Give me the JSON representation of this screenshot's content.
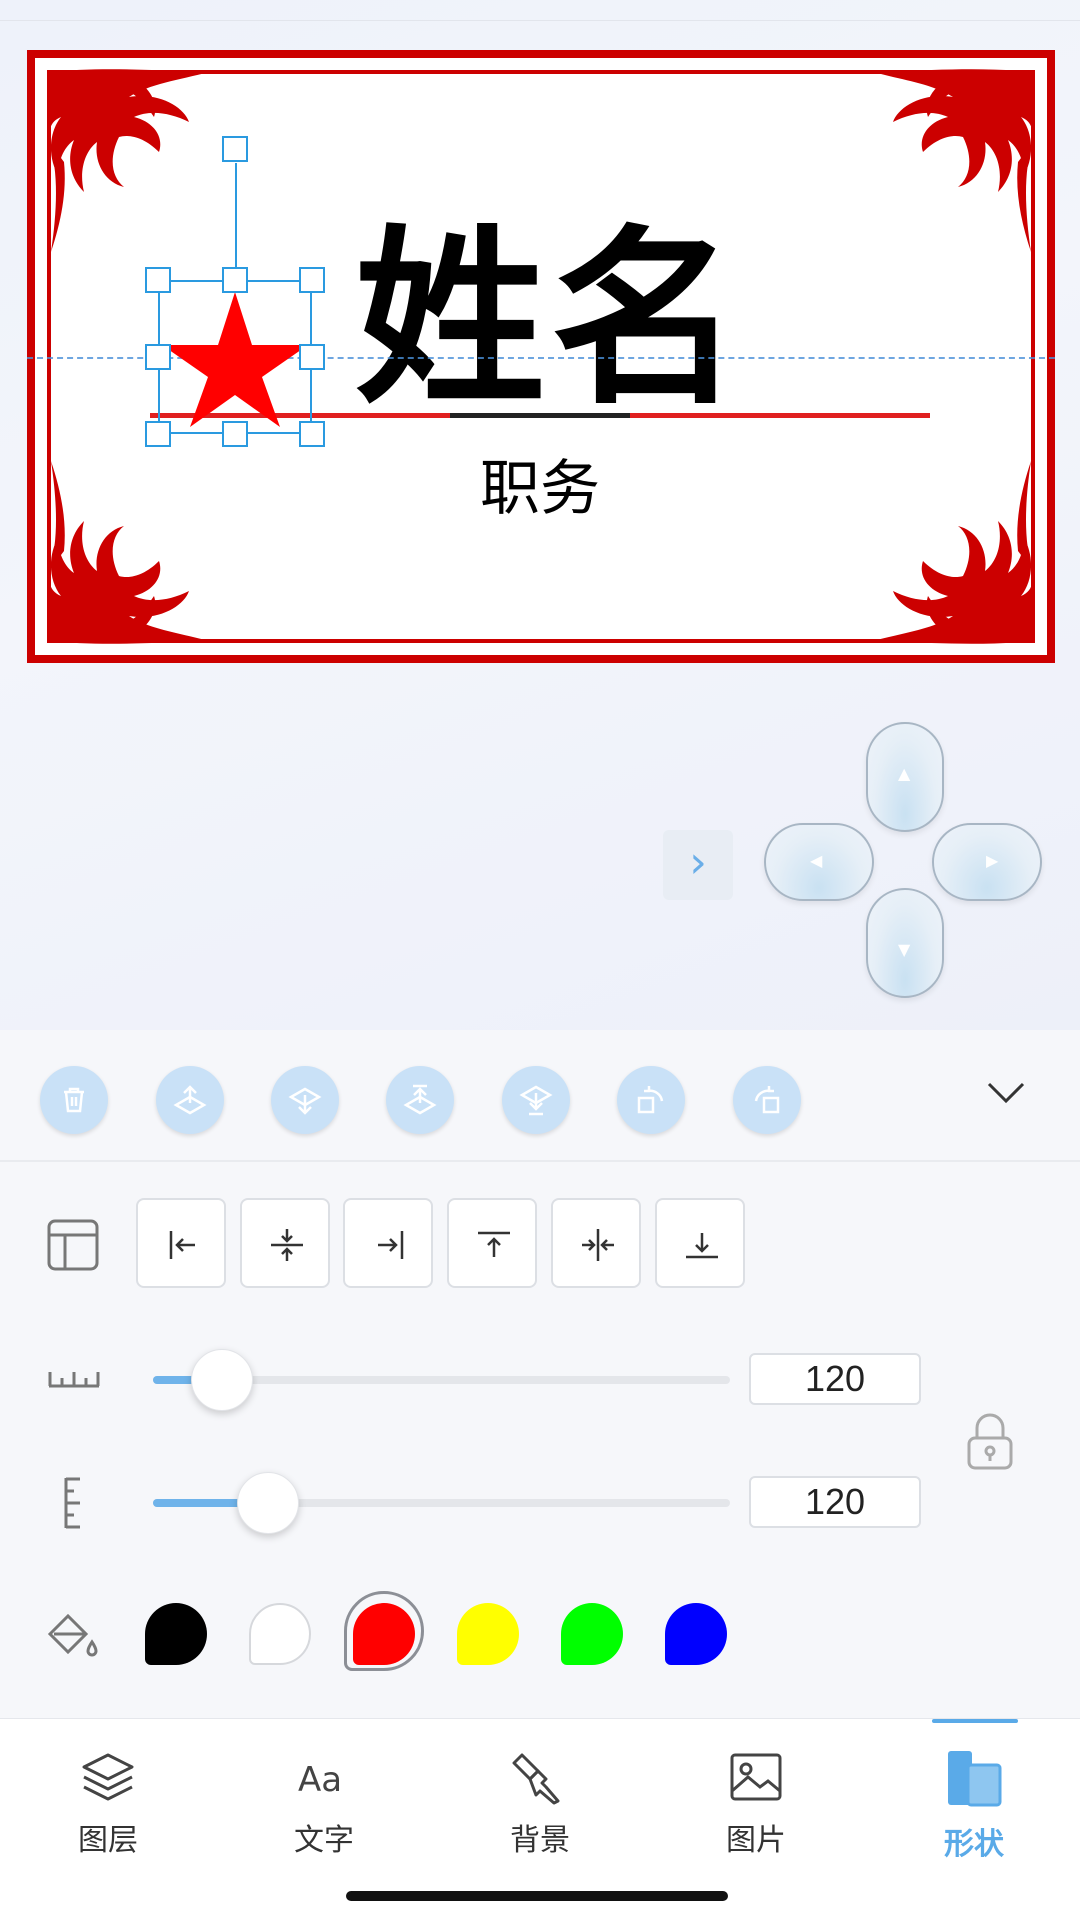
{
  "card": {
    "name_text": "姓名",
    "title_text": "职务",
    "border_color": "#cc0000"
  },
  "dpad": {
    "buttons": [
      "up-icon",
      "left-icon",
      "right-icon",
      "down-icon"
    ]
  },
  "toolbar": {
    "actions": [
      "delete-icon",
      "bring-forward-icon",
      "send-backward-icon",
      "bring-to-front-icon",
      "send-to-back-icon",
      "rotate-left-icon",
      "rotate-right-icon"
    ]
  },
  "align": {
    "buttons": [
      "align-left",
      "align-center-vertical",
      "align-right",
      "align-top",
      "align-center-horizontal",
      "align-bottom"
    ]
  },
  "size": {
    "width_value": "120",
    "height_value": "120",
    "width_fraction": 0.12,
    "height_fraction": 0.2
  },
  "colors": {
    "swatches": [
      "#000000",
      "#ffffff",
      "#ff0000",
      "#ffff00",
      "#00ff00",
      "#0000ff"
    ],
    "selected": "#ff0000"
  },
  "bottom_nav": {
    "items": [
      {
        "label": "图层",
        "icon": "layers-icon"
      },
      {
        "label": "文字",
        "icon": "text-icon"
      },
      {
        "label": "背景",
        "icon": "brush-icon"
      },
      {
        "label": "图片",
        "icon": "image-icon"
      },
      {
        "label": "形状",
        "icon": "shape-icon"
      }
    ],
    "active": "形状"
  }
}
